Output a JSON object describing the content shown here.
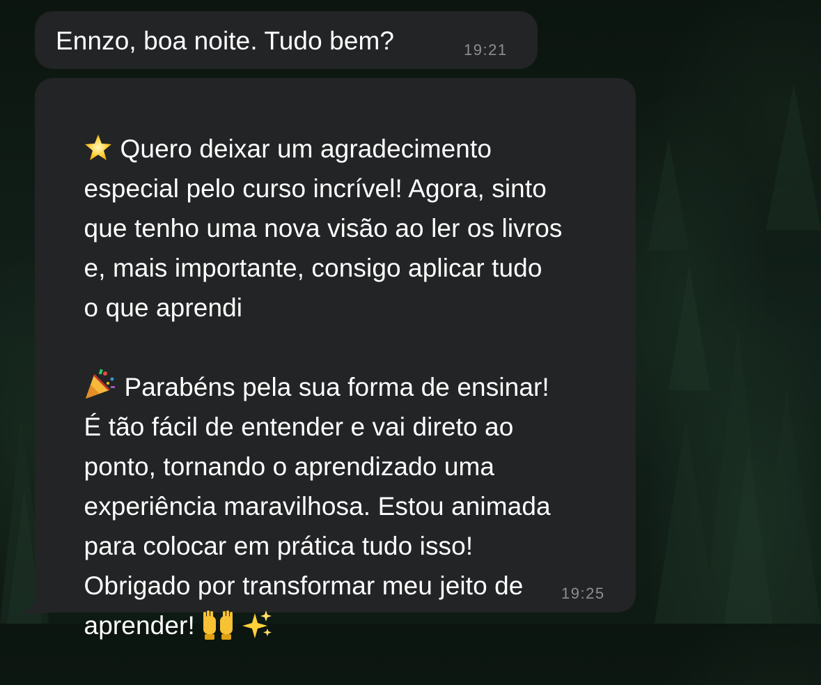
{
  "background": {
    "description_colors": {
      "dark": "#0c1510",
      "tree": "#24402c"
    }
  },
  "colors": {
    "bubble": "#232425",
    "text": "#ffffff",
    "timestamp": "#8e8f91"
  },
  "messages": [
    {
      "text": "Ennzo, boa noite. Tudo bem?",
      "time": "19:21"
    },
    {
      "lines": [
        "Quero deixar um agradecimento",
        "especial pelo curso incrível! Agora, sinto",
        "que tenho uma nova visão ao ler os livros",
        "e, mais importante, consigo aplicar tudo",
        "o que aprendi",
        "",
        "Parabéns pela sua forma de ensinar!",
        "É tão fácil de entender e vai direto ao",
        "ponto, tornando o aprendizado uma",
        "experiência maravilhosa. Estou animada",
        "para colocar em prática tudo isso!",
        "Obrigado por transformar meu jeito de",
        "aprender!"
      ],
      "icons": [
        "star-emoji",
        "party-popper-emoji",
        "raising-hands-emoji",
        "sparkles-emoji"
      ],
      "time": "19:25"
    }
  ]
}
